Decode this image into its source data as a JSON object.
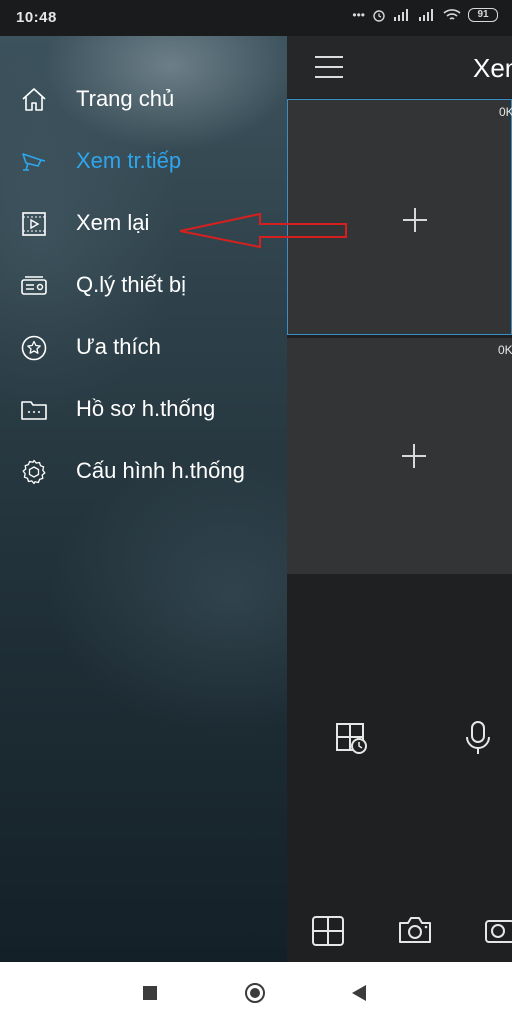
{
  "status_bar": {
    "time": "10:48",
    "battery": "91"
  },
  "live_view": {
    "title": "Xem",
    "cells": [
      {
        "speed": "0K"
      },
      {
        "speed": "0K"
      }
    ]
  },
  "drawer": {
    "items": [
      {
        "label": "Trang chủ",
        "icon": "home-icon",
        "active": false
      },
      {
        "label": "Xem tr.tiếp",
        "icon": "live-camera-icon",
        "active": true
      },
      {
        "label": "Xem lại",
        "icon": "playback-icon",
        "active": false
      },
      {
        "label": "Q.lý thiết bị",
        "icon": "device-management-icon",
        "active": false
      },
      {
        "label": "Ưa thích",
        "icon": "favorites-star-icon",
        "active": false
      },
      {
        "label": "Hồ sơ h.thống",
        "icon": "folder-icon",
        "active": false
      },
      {
        "label": "Cấu hình h.thống",
        "icon": "settings-gear-icon",
        "active": false
      }
    ]
  },
  "colors": {
    "accent": "#2ea6ee",
    "annotation": "#d62020",
    "selected_border": "#3a8fc8"
  }
}
